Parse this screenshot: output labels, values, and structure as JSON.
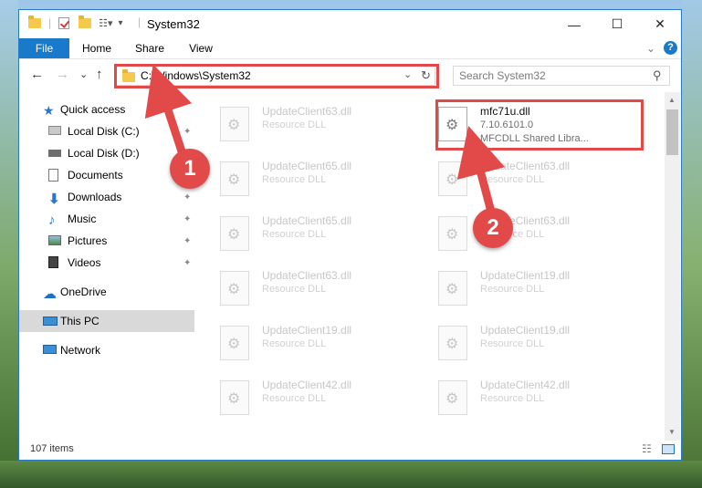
{
  "window": {
    "title": "System32",
    "controls": {
      "minimize": "—",
      "maximize": "☐",
      "close": "✕"
    }
  },
  "ribbon": {
    "tabs": [
      "File",
      "Home",
      "Share",
      "View"
    ],
    "expand_icon": "⌄",
    "help_icon": "?"
  },
  "navbar": {
    "back": "←",
    "forward": "→",
    "recent": "⌄",
    "up": "↑",
    "address": "C:\\Windows\\System32",
    "address_dropdown": "⌄",
    "refresh": "↻",
    "search_placeholder": "Search System32",
    "search_icon": "⚲"
  },
  "sidebar": {
    "items": [
      {
        "label": "Quick access",
        "icon": "star-icon",
        "pinned": false
      },
      {
        "label": "Local Disk (C:)",
        "icon": "drive-icon",
        "pinned": true
      },
      {
        "label": "Local Disk (D:)",
        "icon": "drive-icon",
        "pinned": false
      },
      {
        "label": "Documents",
        "icon": "document-icon",
        "pinned": true
      },
      {
        "label": "Downloads",
        "icon": "download-icon",
        "pinned": true
      },
      {
        "label": "Music",
        "icon": "music-icon",
        "pinned": true
      },
      {
        "label": "Pictures",
        "icon": "pictures-icon",
        "pinned": true
      },
      {
        "label": "Videos",
        "icon": "video-icon",
        "pinned": true
      },
      {
        "label": "OneDrive",
        "icon": "cloud-icon",
        "pinned": false
      },
      {
        "label": "This PC",
        "icon": "computer-icon",
        "pinned": false,
        "selected": true
      },
      {
        "label": "Network",
        "icon": "network-icon",
        "pinned": false
      }
    ],
    "pin_glyph": "📌"
  },
  "files": {
    "left": [
      {
        "name": "UpdateClient63.dll",
        "desc": "Resource DLL"
      },
      {
        "name": "UpdateClient65.dll",
        "desc": "Resource DLL"
      },
      {
        "name": "UpdateClient65.dll",
        "desc": "Resource DLL"
      },
      {
        "name": "UpdateClient63.dll",
        "desc": "Resource DLL"
      },
      {
        "name": "UpdateClient19.dll",
        "desc": "Resource DLL"
      },
      {
        "name": "UpdateClient42.dll",
        "desc": "Resource DLL"
      }
    ],
    "active": {
      "name": "mfc71u.dll",
      "version": "7.10.6101.0",
      "desc": "MFCDLL Shared Libra..."
    },
    "right": [
      {
        "name": "UpdateClient63.dll",
        "desc": "Resource DLL"
      },
      {
        "name": "UpdateClient63.dll",
        "desc": "Resource DLL"
      },
      {
        "name": "UpdateClient19.dll",
        "desc": "Resource DLL"
      },
      {
        "name": "UpdateClient19.dll",
        "desc": "Resource DLL"
      },
      {
        "name": "UpdateClient42.dll",
        "desc": "Resource DLL"
      }
    ]
  },
  "status": {
    "items_count": "107 items"
  },
  "annotations": {
    "badge1": "1",
    "badge2": "2",
    "highlight_color": "#e24a4a"
  }
}
